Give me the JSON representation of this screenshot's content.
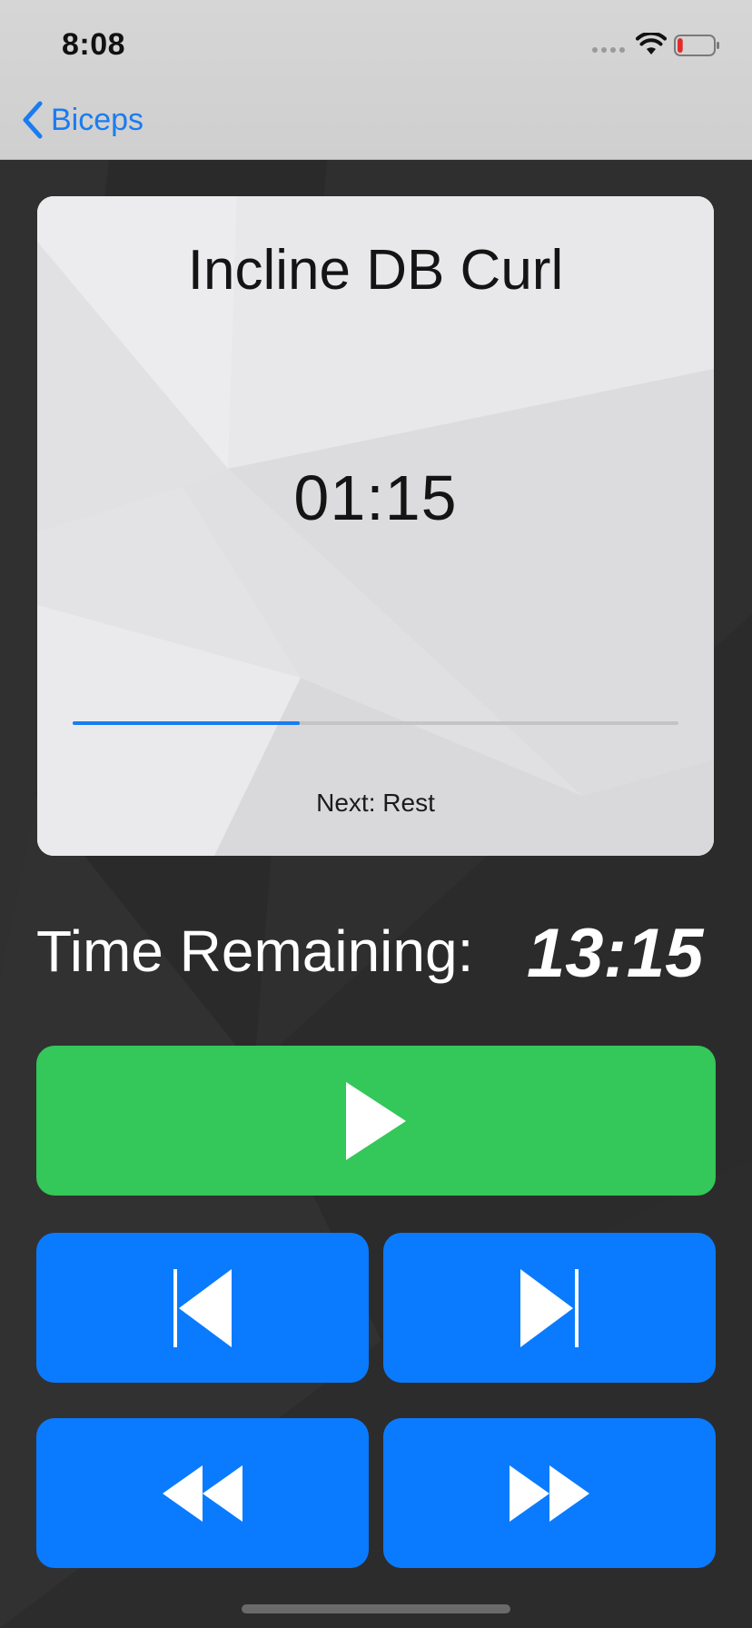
{
  "status_bar": {
    "time": "8:08",
    "signal_icon": "cellular-signal-icon",
    "wifi_icon": "wifi-icon",
    "battery_icon": "battery-low-icon",
    "battery_level": 0.15
  },
  "nav": {
    "back_label": "Biceps",
    "back_icon": "chevron-left-icon"
  },
  "card": {
    "exercise_title": "Incline DB Curl",
    "interval_time": "01:15",
    "progress": 0.375,
    "next_label": "Next: Rest"
  },
  "workout": {
    "remaining_label": "Time Remaining:",
    "remaining_value": "13:15"
  },
  "controls": {
    "play_icon": "play-icon",
    "previous_icon": "skip-previous-icon",
    "next_icon": "skip-next-icon",
    "rewind_icon": "rewind-icon",
    "fast_forward_icon": "fast-forward-icon"
  },
  "colors": {
    "accent_blue": "#0a7bfe",
    "play_green": "#34c759",
    "background": "#2d2d2e",
    "card": "#e6e6e8"
  }
}
